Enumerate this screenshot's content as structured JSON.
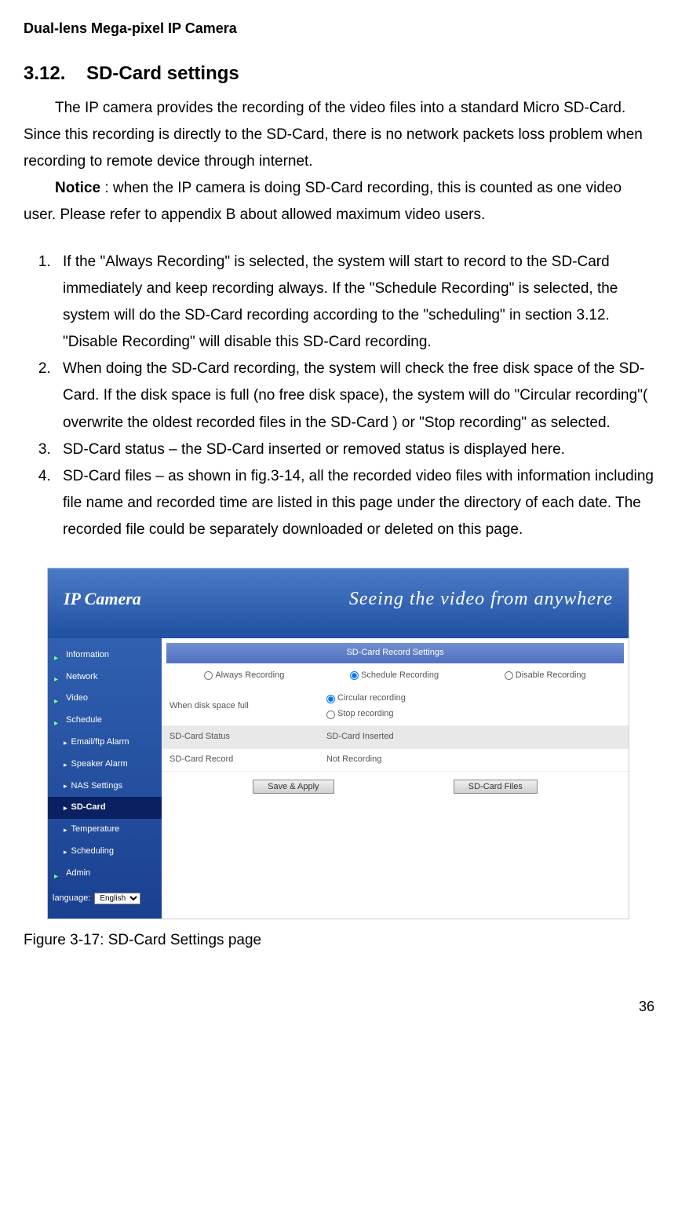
{
  "header": "Dual-lens Mega-pixel IP Camera",
  "section": {
    "number": "3.12.",
    "title": "SD-Card settings"
  },
  "intro": "The IP camera provides the recording of the video files into a standard Micro SD-Card. Since this recording is directly to the SD-Card, there is no network packets loss problem when recording to remote device through internet.",
  "notice_label": "Notice",
  "notice_text": " : when the IP camera is doing SD-Card recording, this is counted as one video user. Please refer to appendix B about allowed maximum video users.",
  "list": {
    "item1": "If the \"Always Recording\" is selected, the system will start to record to the SD-Card immediately and keep recording always. If the \"Schedule Recording\" is selected, the system will do the SD-Card recording according to the \"scheduling\" in section 3.12. \"Disable Recording\" will disable this SD-Card recording.",
    "item2": "When doing the SD-Card recording, the system will check the free disk space of the SD-Card. If the disk space is full (no free disk space), the system will do \"Circular recording\"( overwrite the oldest recorded files in the SD-Card ) or \"Stop recording\" as selected.",
    "item3": "SD-Card status – the SD-Card inserted or removed status is displayed here.",
    "item4": "SD-Card files – as shown in fig.3-14, all the recorded video files with information including file name and recorded time are listed in this page under the directory of each date. The recorded file could be separately downloaded or deleted on this page."
  },
  "screenshot": {
    "banner_left": "IP Camera",
    "banner_right": "Seeing the video from anywhere",
    "sidebar": {
      "information": "Information",
      "network": "Network",
      "video": "Video",
      "schedule": "Schedule",
      "email_ftp": "Email/ftp Alarm",
      "speaker": "Speaker Alarm",
      "nas": "NAS Settings",
      "sdcard": "SD-Card",
      "temperature": "Temperature",
      "scheduling": "Scheduling",
      "admin": "Admin",
      "language_label": "language:",
      "language_value": "English"
    },
    "content": {
      "title": "SD-Card Record Settings",
      "opt_always": "Always Recording",
      "opt_schedule": "Schedule Recording",
      "opt_disable": "Disable Recording",
      "row_disk_label": "When disk space full",
      "opt_circular": "Circular recording",
      "opt_stop": "Stop recording",
      "row_status_label": "SD-Card Status",
      "row_status_value": "SD-Card Inserted",
      "row_record_label": "SD-Card Record",
      "row_record_value": "Not Recording",
      "btn_save": "Save & Apply",
      "btn_files": "SD-Card Files"
    }
  },
  "figure_caption": "Figure 3-17: SD-Card Settings page",
  "page_number": "36"
}
